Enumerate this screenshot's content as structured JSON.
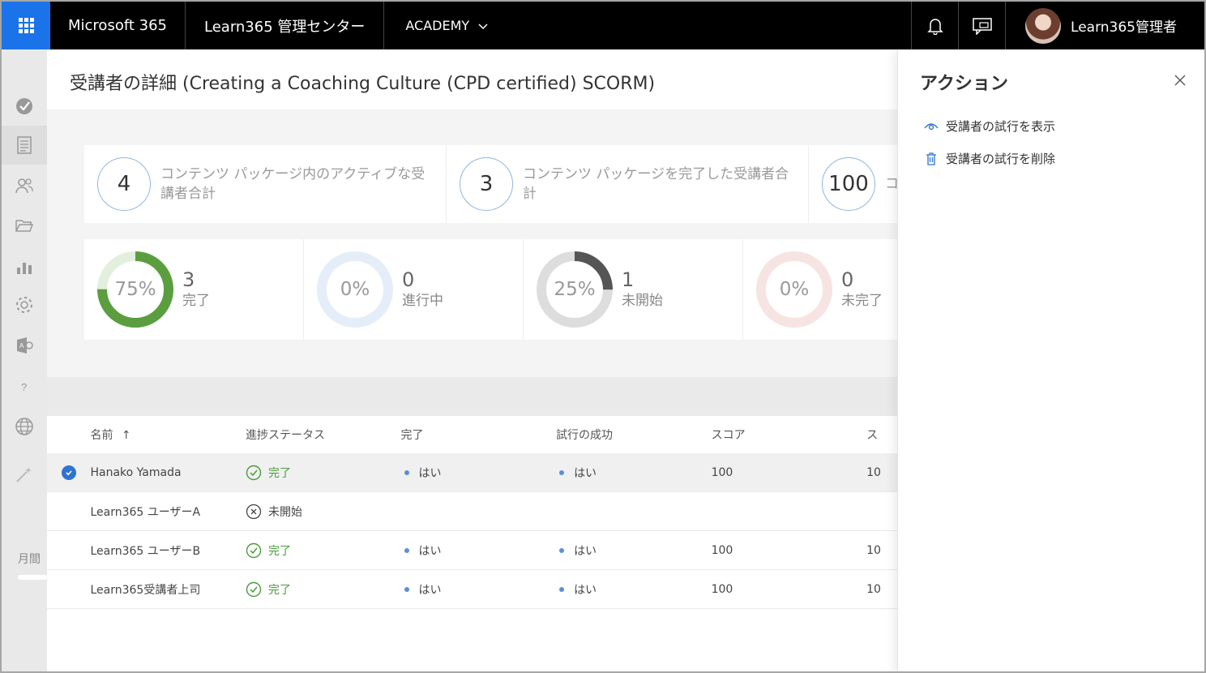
{
  "topbar": {
    "suite": "Microsoft 365",
    "admin_center": "Learn365 管理センター",
    "tenant": "ACADEMY",
    "user_name": "Learn365管理者"
  },
  "rail": {
    "truncated_label": "月間",
    "icons": [
      "check-circle-icon",
      "document-icon",
      "people-icon",
      "folder-icon",
      "chart-icon",
      "gear-icon",
      "exchange-icon",
      "help-icon",
      "globe-icon",
      "wand-icon"
    ]
  },
  "page": {
    "title": "受講者の詳細",
    "course": "(Creating a Coaching Culture (CPD certified) SCORM)"
  },
  "kpis": [
    {
      "value": "4",
      "label": "コンテンツ パッケージ内のアクティブな受講者合計"
    },
    {
      "value": "3",
      "label": "コンテンツ パッケージを完了した受講者合計"
    },
    {
      "value": "100",
      "label": "コ"
    }
  ],
  "status_cards": [
    {
      "percent": "75%",
      "count": "3",
      "label": "完了",
      "fraction": 0.75,
      "color": "#5b9e3f",
      "track": "#e2efdc"
    },
    {
      "percent": "0%",
      "count": "0",
      "label": "進行中",
      "fraction": 0,
      "color": "#2f74d0",
      "track": "#e5edf9"
    },
    {
      "percent": "25%",
      "count": "1",
      "label": "未開始",
      "fraction": 0.25,
      "color": "#555555",
      "track": "#dddddd"
    },
    {
      "percent": "0%",
      "count": "0",
      "label": "未完了",
      "fraction": 0,
      "color": "#d9534f",
      "track": "#f6e4e3"
    }
  ],
  "table": {
    "columns": [
      "名前",
      "進捗ステータス",
      "完了",
      "試行の成功",
      "スコア",
      "ス"
    ],
    "sort_indicator": "↑",
    "rows": [
      {
        "name": "Hanako Yamada",
        "status": "完了",
        "done": "はい",
        "success": "はい",
        "score": "100",
        "extra": "10",
        "selected": true,
        "complete": true
      },
      {
        "name": "Learn365 ユーザーA",
        "status": "未開始",
        "done": "",
        "success": "",
        "score": "",
        "extra": "",
        "selected": false,
        "complete": false
      },
      {
        "name": "Learn365 ユーザーB",
        "status": "完了",
        "done": "はい",
        "success": "はい",
        "score": "100",
        "extra": "10",
        "selected": false,
        "complete": true
      },
      {
        "name": "Learn365受講者上司",
        "status": "完了",
        "done": "はい",
        "success": "はい",
        "score": "100",
        "extra": "10",
        "selected": false,
        "complete": true
      }
    ]
  },
  "panel": {
    "title": "アクション",
    "actions": [
      {
        "label": "受講者の試行を表示",
        "icon": "eye-icon"
      },
      {
        "label": "受講者の試行を削除",
        "icon": "trash-icon"
      }
    ]
  }
}
